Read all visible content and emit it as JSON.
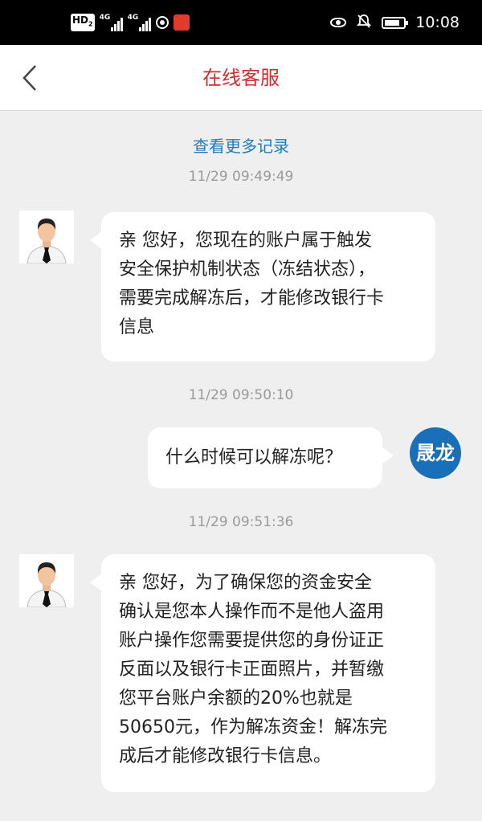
{
  "status_bar": {
    "hd": "HD",
    "hd_sub": "2",
    "net1": "4G",
    "net2": "4G",
    "time": "10:08",
    "icons": [
      "hd-icon",
      "signal-icon",
      "signal-icon",
      "vpn-icon",
      "app-icon",
      "eye-icon",
      "mute-icon",
      "battery-icon"
    ]
  },
  "header": {
    "back_icon": "chevron-left-icon",
    "title": "在线客服"
  },
  "chat": {
    "load_more": "查看更多记录",
    "messages": [
      {
        "time": "11/29 09:49:49",
        "from": "agent",
        "text": "亲 您好，您现在的账户属于触发\n安全保护机制状态（冻结状态），\n需要完成解冻后，才能修改银行卡\n信息"
      },
      {
        "time": "11/29 09:50:10",
        "from": "user",
        "avatar_text": "晟龙",
        "text": "什么时候可以解冻呢？"
      },
      {
        "time": "11/29 09:51:36",
        "from": "agent",
        "text": "亲 您好，为了确保您的资金安全\n确认是您本人操作而不是他人盗用\n账户操作您需要提供您的身份证正\n反面以及银行卡正面照片，并暂缴\n您平台账户余额的20%也就是\n50650元，作为解冻资金！解冻完\n成后才能修改银行卡信息。"
      }
    ]
  },
  "colors": {
    "title": "#d32b2b",
    "link": "#1f7bc0",
    "user_avatar": "#1a70b8",
    "background": "#efefef"
  }
}
